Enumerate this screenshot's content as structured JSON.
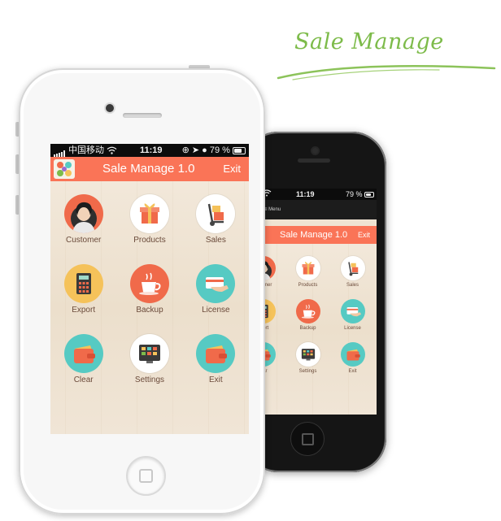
{
  "brand": {
    "title": "Sale Manage",
    "color": "#7dbb4a"
  },
  "colors": {
    "titlebar": "#fa7457",
    "label_text": "#6a4a3a",
    "background_wood": "#efe3d2"
  },
  "front_phone": {
    "statusbar": {
      "carrier": "中国移动",
      "time": "11:19",
      "battery": "79 %"
    },
    "titlebar": {
      "title": "Sale Manage 1.0",
      "exit_label": "Exit",
      "logo_icon": "colorful-pinwheel-logo-icon"
    },
    "menu": [
      {
        "label": "Customer",
        "icon": "customer-icon",
        "color": "#f06a4a"
      },
      {
        "label": "Products",
        "icon": "gift-box-icon",
        "color": "#ffffff"
      },
      {
        "label": "Sales",
        "icon": "hand-truck-icon",
        "color": "#ffffff"
      },
      {
        "label": "Export",
        "icon": "calculator-icon",
        "color": "#f5c25a"
      },
      {
        "label": "Backup",
        "icon": "coffee-cup-icon",
        "color": "#f06a4a"
      },
      {
        "label": "License",
        "icon": "card-in-hand-icon",
        "color": "#56cac3"
      },
      {
        "label": "Clear",
        "icon": "wallet-icon",
        "color": "#56cac3"
      },
      {
        "label": "Settings",
        "icon": "control-panel-icon",
        "color": "#ffffff"
      },
      {
        "label": "Exit",
        "icon": "wallet-exit-icon",
        "color": "#56cac3"
      }
    ]
  },
  "back_phone": {
    "statusbar": {
      "time": "11:19",
      "battery": "79 %"
    },
    "menubar": {
      "label": "≡ Menu"
    },
    "titlebar": {
      "title": "Sale Manage 1.0",
      "exit_label": "Exit"
    },
    "menu": [
      {
        "label": "ustomer",
        "icon": "customer-icon",
        "color": "#f06a4a"
      },
      {
        "label": "Products",
        "icon": "gift-box-icon",
        "color": "#ffffff"
      },
      {
        "label": "Sales",
        "icon": "hand-truck-icon",
        "color": "#ffffff"
      },
      {
        "label": "xport",
        "icon": "calculator-icon",
        "color": "#f5c25a"
      },
      {
        "label": "Backup",
        "icon": "coffee-cup-icon",
        "color": "#f06a4a"
      },
      {
        "label": "License",
        "icon": "card-in-hand-icon",
        "color": "#56cac3"
      },
      {
        "label": "lear",
        "icon": "wallet-icon",
        "color": "#56cac3"
      },
      {
        "label": "Settings",
        "icon": "control-panel-icon",
        "color": "#ffffff"
      },
      {
        "label": "Exit",
        "icon": "wallet-exit-icon",
        "color": "#56cac3"
      }
    ]
  }
}
